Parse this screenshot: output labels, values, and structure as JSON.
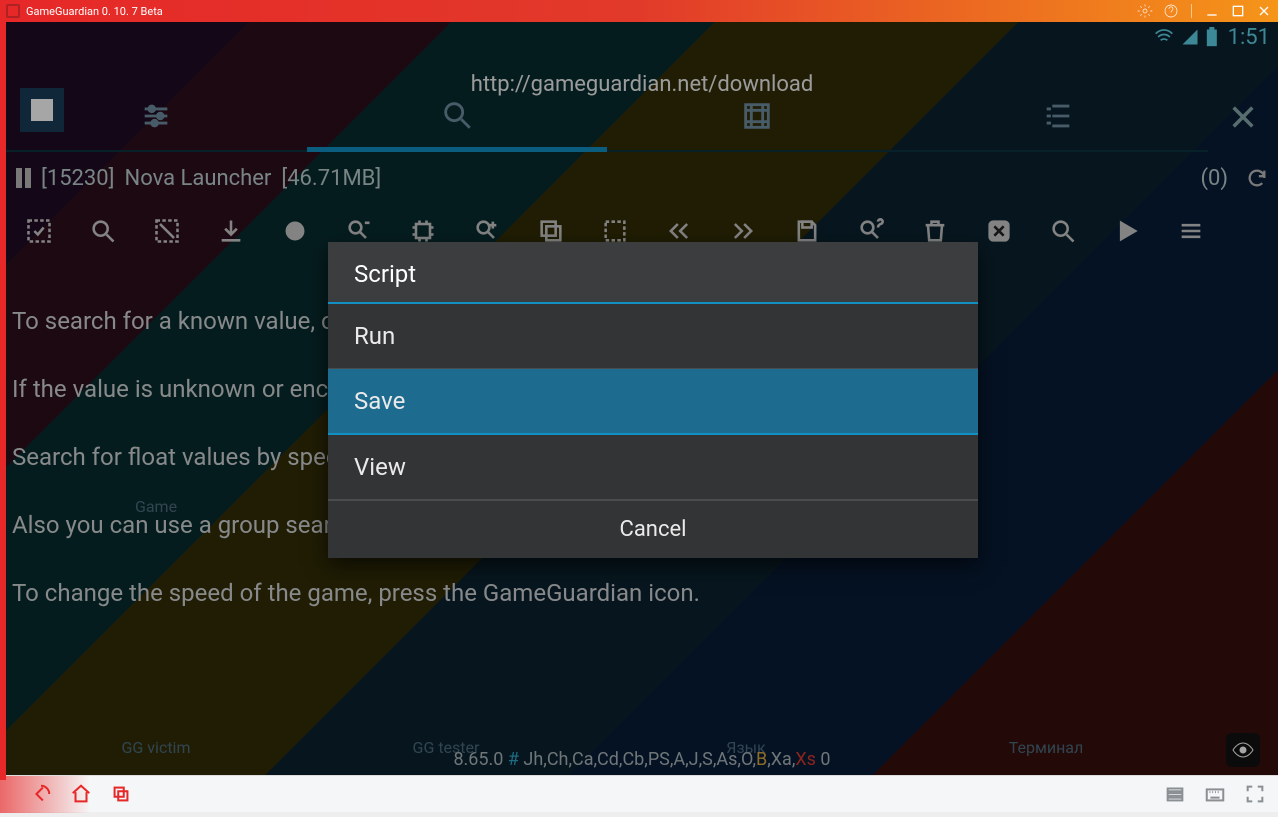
{
  "window": {
    "title": "GameGuardian 0. 10. 7 Beta"
  },
  "statusbar": {
    "clock": "1:51"
  },
  "url": "http://gameguardian.net/download",
  "process": {
    "pid": "[15230]",
    "name": "Nova Launcher",
    "mem": "[46.71MB]",
    "count": "(0)"
  },
  "hints": {
    "l1": "To search for a known value, click on the 'Known' button.",
    "l2": "If the value is unknown or encrypted then use the 'Fuzzy' search.",
    "l3": "Search for float values by specifying the 'Float' or 'Auto' search type.",
    "l4": "Also you can use a group search.",
    "l5": "To change the speed of the game, press the GameGuardian icon."
  },
  "version": {
    "ver": "8.65.0",
    "langs": " Jh,Ch,Ca,Cd,Cb,PS,A,J,S,As,O,",
    "b": "B",
    "comma": ",Xa,",
    "xs": "Xs",
    "tail": " 0"
  },
  "bg": {
    "game": "Game",
    "victim": "GG victim",
    "tester": "GG tester",
    "lang": "Язык",
    "term": "Терминал"
  },
  "dialog": {
    "title": "Script",
    "items": [
      "Run",
      "Save",
      "View"
    ],
    "selected": 1,
    "cancel": "Cancel"
  }
}
